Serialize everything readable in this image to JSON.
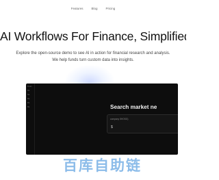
{
  "nav": {
    "items": [
      {
        "label": "Features"
      },
      {
        "label": "Blog"
      },
      {
        "label": "Pricing"
      }
    ]
  },
  "hero": {
    "title": "AI Workflows For Finance, Simplified",
    "subtitle": "Explore the open-source demo to see AI in action for financial research and analysis. We help funds turn custom data into insights."
  },
  "demo": {
    "sidebar_lines": [
      "Finan",
      "Re",
      "Ne",
      "Re",
      "Re",
      "Re"
    ],
    "title": "Search market ne",
    "search_placeholder": "company SHOSG)",
    "search_symbol": "$"
  },
  "watermark": {
    "text": "百库自助链"
  }
}
